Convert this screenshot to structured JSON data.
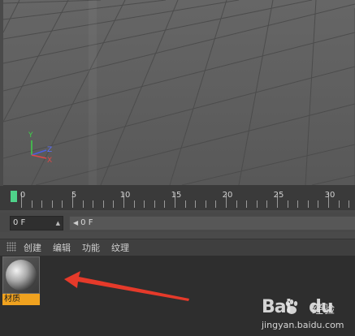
{
  "timeline": {
    "ticks": [
      {
        "label": "0"
      },
      {
        "label": "5"
      },
      {
        "label": "10"
      },
      {
        "label": "15"
      },
      {
        "label": "20"
      },
      {
        "label": "25"
      },
      {
        "label": "30"
      }
    ]
  },
  "frame_controls": {
    "start_value": "0 F",
    "end_value": "0 F"
  },
  "material_manager": {
    "menu": [
      "创建",
      "编辑",
      "功能",
      "纹理"
    ],
    "materials": [
      {
        "label": "材质"
      }
    ]
  },
  "viewport": {
    "axis_labels": {
      "y": "Y",
      "z": "Z",
      "x": "X"
    }
  },
  "watermark": {
    "logo": "Bai",
    "logo_suffix": "du",
    "brand": "经验",
    "url": "jingyan.baidu.com"
  },
  "colors": {
    "playhead": "#4fd38a",
    "material_label_bg": "#f0a21f",
    "arrow": "#e53a2a"
  }
}
